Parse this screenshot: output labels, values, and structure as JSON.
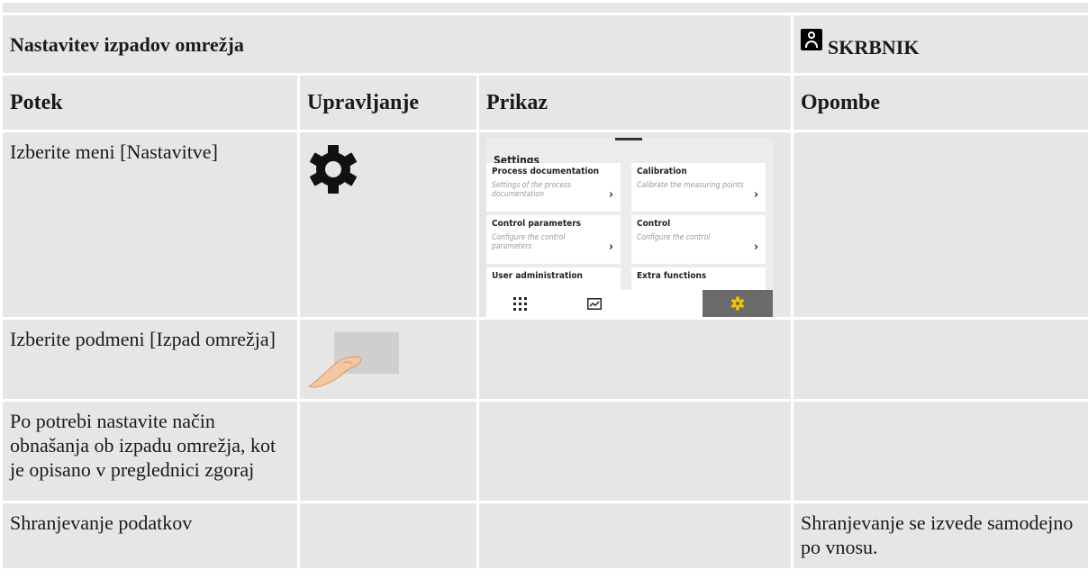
{
  "title": "Nastavitev izpadov omrežja",
  "role": "SKRBNIK",
  "headers": {
    "col1": "Potek",
    "col2": "Upravljanje",
    "col3": "Prikaz",
    "col4": "Opombe"
  },
  "rows": [
    {
      "step": "Izberite meni [Nastavitve]",
      "control_icon": "gear-icon",
      "note": ""
    },
    {
      "step": "Izberite podmeni [Izpad omrežja]",
      "control_icon": "touch-finger-icon",
      "note": ""
    },
    {
      "step": "Po potrebi nastavite način obnašanja ob izpadu omrežja, kot je opisano v preglednici zgoraj",
      "note": ""
    },
    {
      "step": "Shranjevanje podatkov",
      "note": "Shranjevanje se izvede samodejno po vnosu."
    }
  ],
  "device": {
    "title": "Settings",
    "tiles": [
      {
        "title": "Process documentation",
        "subtitle": "Settings of the process documentation"
      },
      {
        "title": "Calibration",
        "subtitle": "Calibrate the measuring points"
      },
      {
        "title": "Control parameters",
        "subtitle": "Configure the control parameters"
      },
      {
        "title": "Control",
        "subtitle": "Configure the control"
      },
      {
        "title": "User administration",
        "subtitle": ""
      },
      {
        "title": "Extra functions",
        "subtitle": ""
      }
    ],
    "nav_icons": [
      "grid-icon",
      "chart-icon",
      "gear-icon"
    ],
    "active_color": "#6a6a6a",
    "active_icon_color": "#f5c400"
  },
  "colors": {
    "cell_bg": "#e6e6e6"
  }
}
